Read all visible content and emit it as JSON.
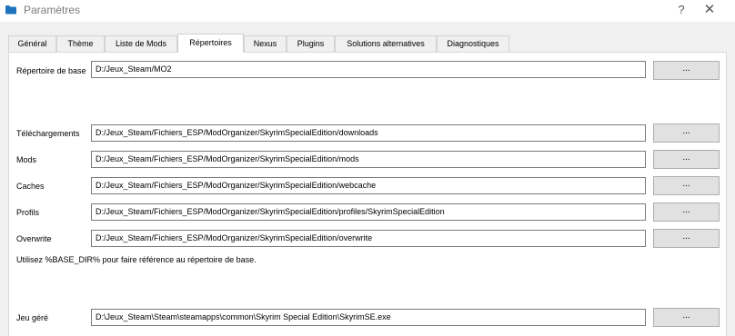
{
  "window": {
    "title": "Paramètres",
    "help": "?",
    "close": "✕"
  },
  "tabs": [
    {
      "label": "Général"
    },
    {
      "label": "Thème"
    },
    {
      "label": "Liste de Mods"
    },
    {
      "label": "Répertoires"
    },
    {
      "label": "Nexus"
    },
    {
      "label": "Plugins"
    },
    {
      "label": "Solutions alternatives"
    },
    {
      "label": "Diagnostiques"
    }
  ],
  "active_tab": "Répertoires",
  "base": {
    "label": "Répertoire de base",
    "value": "D:/Jeux_Steam/MO2",
    "button": "..."
  },
  "dirs": [
    {
      "label": "Téléchargements",
      "value": "D:/Jeux_Steam/Fichiers_ESP/ModOrganizer/SkyrimSpecialEdition/downloads",
      "button": "..."
    },
    {
      "label": "Mods",
      "value": "D:/Jeux_Steam/Fichiers_ESP/ModOrganizer/SkyrimSpecialEdition/mods",
      "button": "..."
    },
    {
      "label": "Caches",
      "value": "D:/Jeux_Steam/Fichiers_ESP/ModOrganizer/SkyrimSpecialEdition/webcache",
      "button": "..."
    },
    {
      "label": "Profils",
      "value": "D:/Jeux_Steam/Fichiers_ESP/ModOrganizer/SkyrimSpecialEdition/profiles/SkyrimSpecialEdition",
      "button": "..."
    },
    {
      "label": "Overwrite",
      "value": "D:/Jeux_Steam/Fichiers_ESP/ModOrganizer/SkyrimSpecialEdition/overwrite",
      "button": "..."
    }
  ],
  "hint": "Utilisez %BASE_DIR% pour faire référence au répertoire de base.",
  "game": {
    "label": "Jeu géré",
    "value": "D:\\Jeux_Steam\\Steam\\steamapps\\common\\Skyrim Special Edition\\SkyrimSE.exe",
    "button": "..."
  },
  "colors": {
    "icon": "#1e73be",
    "panel": "#ffffff",
    "background": "#f0f0f0"
  }
}
